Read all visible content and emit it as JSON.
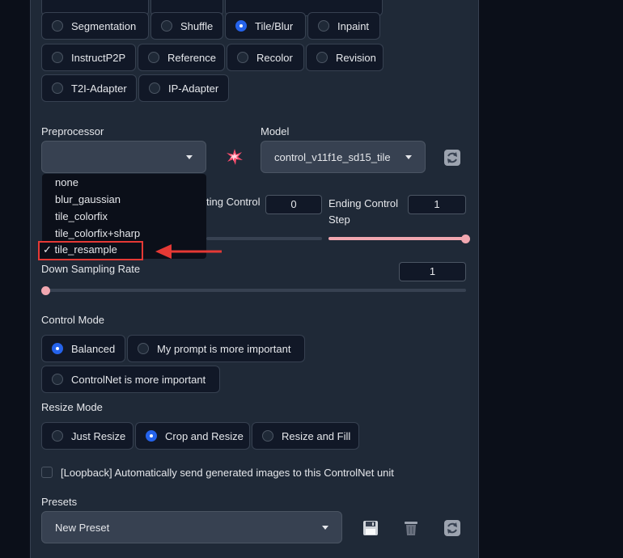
{
  "control_types": {
    "row1": [
      "Segmentation",
      "Shuffle",
      "Tile/Blur",
      "Inpaint"
    ],
    "row2": [
      "InstructP2P",
      "Reference",
      "Recolor",
      "Revision"
    ],
    "row3": [
      "T2I-Adapter",
      "IP-Adapter"
    ],
    "selected": "Tile/Blur"
  },
  "preprocessor": {
    "label": "Preprocessor",
    "value": "",
    "options": [
      "none",
      "blur_gaussian",
      "tile_colorfix",
      "tile_colorfix+sharp",
      "tile_resample"
    ],
    "checked_option": "tile_resample",
    "check_mark": "✓"
  },
  "model": {
    "label": "Model",
    "value": "control_v11f1e_sd15_tile"
  },
  "starting_control": {
    "label": "ting Control",
    "value": "0"
  },
  "ending_control": {
    "label_line1": "Ending Control",
    "label_line2": "Step",
    "value": "1",
    "level": 1.0
  },
  "down_sampling": {
    "label": "Down Sampling Rate",
    "value": "1",
    "level": 0.0
  },
  "control_mode": {
    "label": "Control Mode",
    "options": [
      "Balanced",
      "My prompt is more important",
      "ControlNet is more important"
    ],
    "selected": "Balanced"
  },
  "resize_mode": {
    "label": "Resize Mode",
    "options": [
      "Just Resize",
      "Crop and Resize",
      "Resize and Fill"
    ],
    "selected": "Crop and Resize"
  },
  "loopback": {
    "label": "[Loopback] Automatically send generated images to this ControlNet unit",
    "checked": false
  },
  "presets": {
    "label": "Presets",
    "value": "New Preset"
  },
  "annotation": {
    "highlight_color": "#e53935",
    "arrow_color": "#e53935"
  },
  "colors": {
    "accent": "#2563eb",
    "slider": "#f1a7b0"
  }
}
